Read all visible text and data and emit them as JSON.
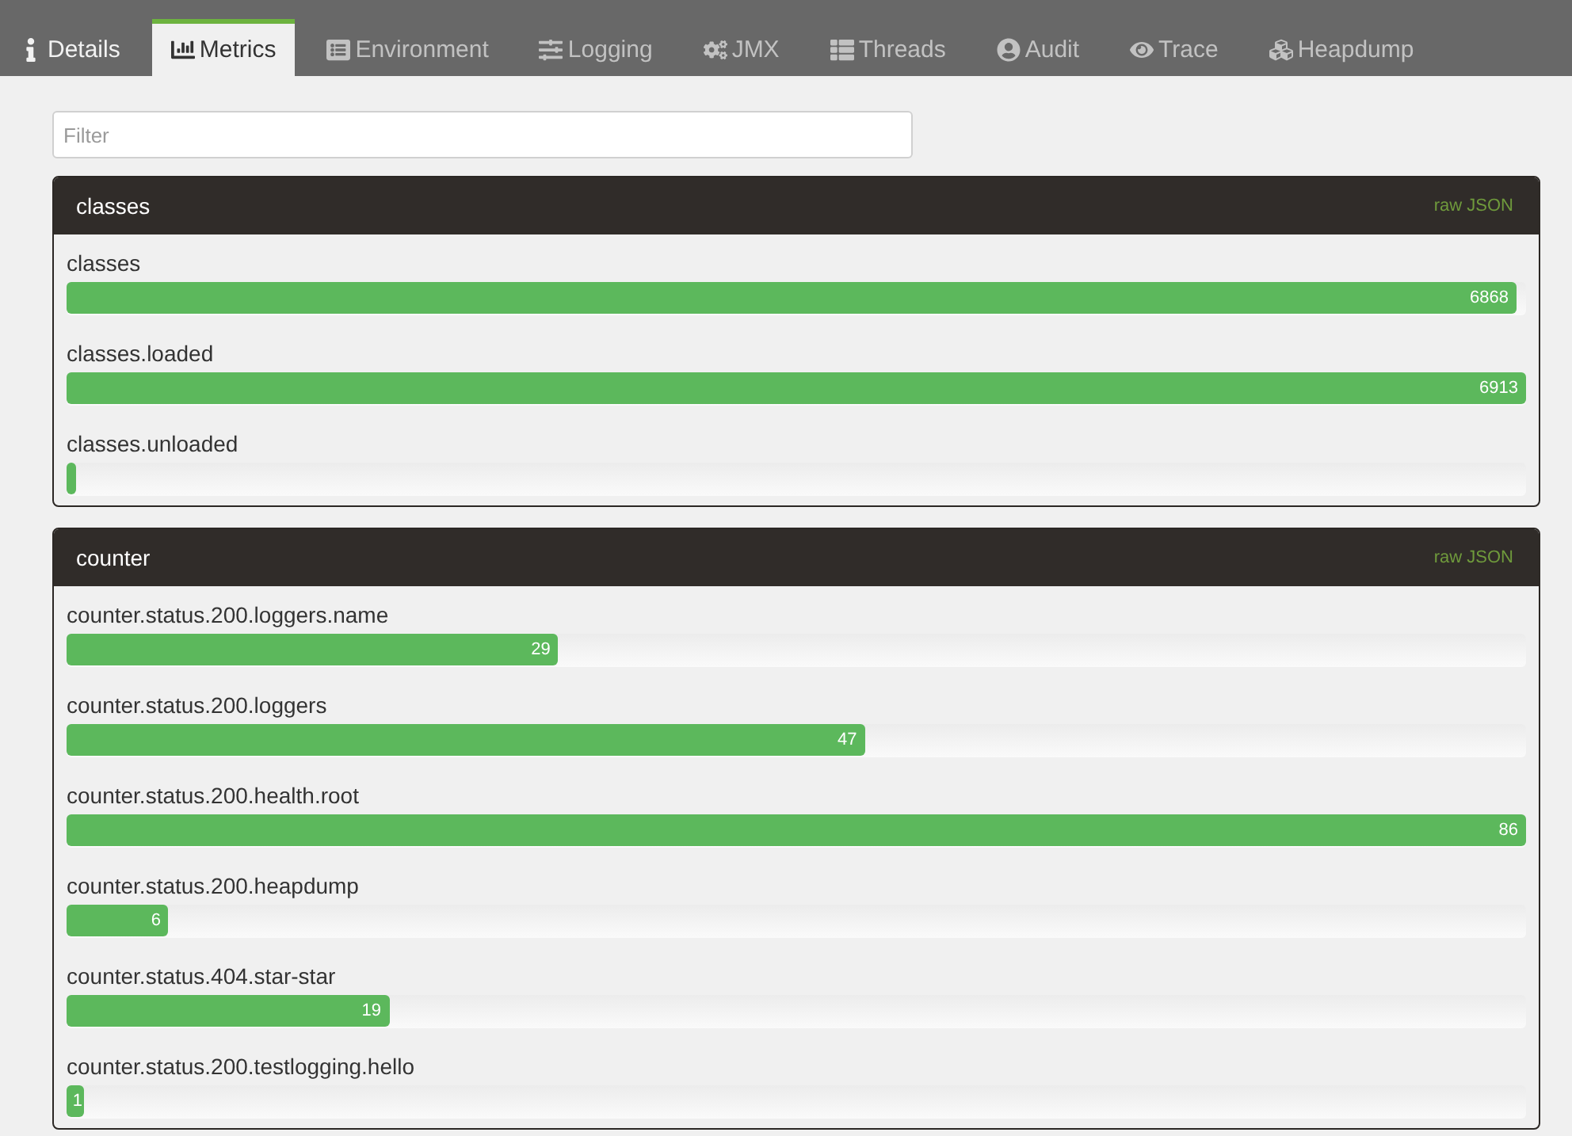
{
  "tabs": [
    {
      "label": "Details",
      "selected": false,
      "disabled": false
    },
    {
      "label": "Metrics",
      "selected": true,
      "disabled": false
    },
    {
      "label": "Environment",
      "selected": false,
      "disabled": true
    },
    {
      "label": "Logging",
      "selected": false,
      "disabled": true
    },
    {
      "label": "JMX",
      "selected": false,
      "disabled": true
    },
    {
      "label": "Threads",
      "selected": false,
      "disabled": true
    },
    {
      "label": "Audit",
      "selected": false,
      "disabled": true
    },
    {
      "label": "Trace",
      "selected": false,
      "disabled": true
    },
    {
      "label": "Heapdump",
      "selected": false,
      "disabled": true
    }
  ],
  "filter": {
    "placeholder": "Filter"
  },
  "panels": [
    {
      "title": "classes",
      "link": "raw JSON",
      "metrics": [
        {
          "name": "classes",
          "value": "6868",
          "level": 0.9935
        },
        {
          "name": "classes.loaded",
          "value": "6913",
          "level": 1
        },
        {
          "name": "classes.unloaded",
          "level": 0.0065
        }
      ]
    },
    {
      "title": "counter",
      "link": "raw JSON",
      "metrics": [
        {
          "name": "counter.status.200.loggers.name",
          "value": "29",
          "level": 0.337
        },
        {
          "name": "counter.status.200.loggers",
          "value": "47",
          "level": 0.547
        },
        {
          "name": "counter.status.200.health.root",
          "value": "86",
          "level": 1
        },
        {
          "name": "counter.status.200.heapdump",
          "value": "6",
          "level": 0.07
        },
        {
          "name": "counter.status.404.star-star",
          "value": "19",
          "level": 0.221
        },
        {
          "name": "counter.status.200.testlogging.hello",
          "value": "1",
          "level": 0.012
        }
      ]
    }
  ]
}
